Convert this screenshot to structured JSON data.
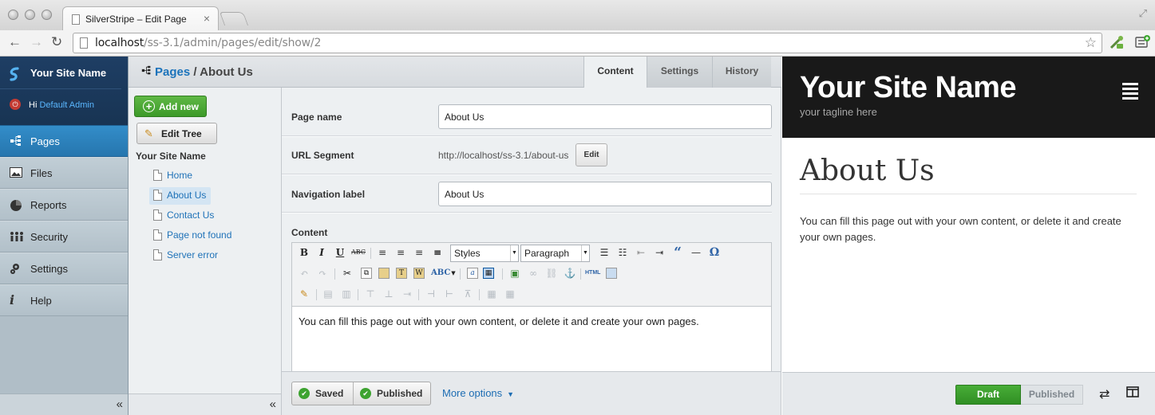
{
  "browser": {
    "tab_title": "SilverStripe – Edit Page",
    "url_host": "localhost",
    "url_path": "/ss-3.1/admin/pages/edit/show/2"
  },
  "cms": {
    "site_name": "Your Site Name",
    "greeting": "Hi",
    "user": "Default Admin",
    "nav": [
      {
        "label": "Pages",
        "icon": "sitetree-icon",
        "active": true
      },
      {
        "label": "Files",
        "icon": "image-icon",
        "active": false
      },
      {
        "label": "Reports",
        "icon": "pie-chart-icon",
        "active": false
      },
      {
        "label": "Security",
        "icon": "people-icon",
        "active": false
      },
      {
        "label": "Settings",
        "icon": "gear-icon",
        "active": false
      },
      {
        "label": "Help",
        "icon": "info-icon",
        "active": false
      }
    ],
    "collapse": "«"
  },
  "breadcrumb": {
    "root": "Pages",
    "separator": " / ",
    "current": "About Us"
  },
  "tree": {
    "add_new": "Add new",
    "edit_tree": "Edit Tree",
    "root": "Your Site Name",
    "items": [
      "Home",
      "About Us",
      "Contact Us",
      "Page not found",
      "Server error"
    ],
    "selected": "About Us",
    "collapse": "«"
  },
  "tabs": [
    "Content",
    "Settings",
    "History"
  ],
  "active_tab": "Content",
  "form": {
    "page_name_label": "Page name",
    "page_name": "About Us",
    "url_segment_label": "URL Segment",
    "url_segment": "http://localhost/ss-3.1/about-us",
    "url_edit": "Edit",
    "nav_label_label": "Navigation label",
    "nav_label": "About Us",
    "content_label": "Content",
    "styles_select": "Styles",
    "format_select": "Paragraph",
    "content": "You can fill this page out with your own content, or delete it and create your own pages."
  },
  "actions": {
    "saved": "Saved",
    "published": "Published",
    "more_options": "More options"
  },
  "preview": {
    "site_name": "Your Site Name",
    "tagline": "your tagline here",
    "title": "About Us",
    "body": "You can fill this page out with your own content, or delete it and create your own pages.",
    "draft": "Draft",
    "published": "Published"
  },
  "colors": {
    "cms_blue": "#2a7fc0",
    "green": "#3da330",
    "preview_header": "#191919"
  }
}
